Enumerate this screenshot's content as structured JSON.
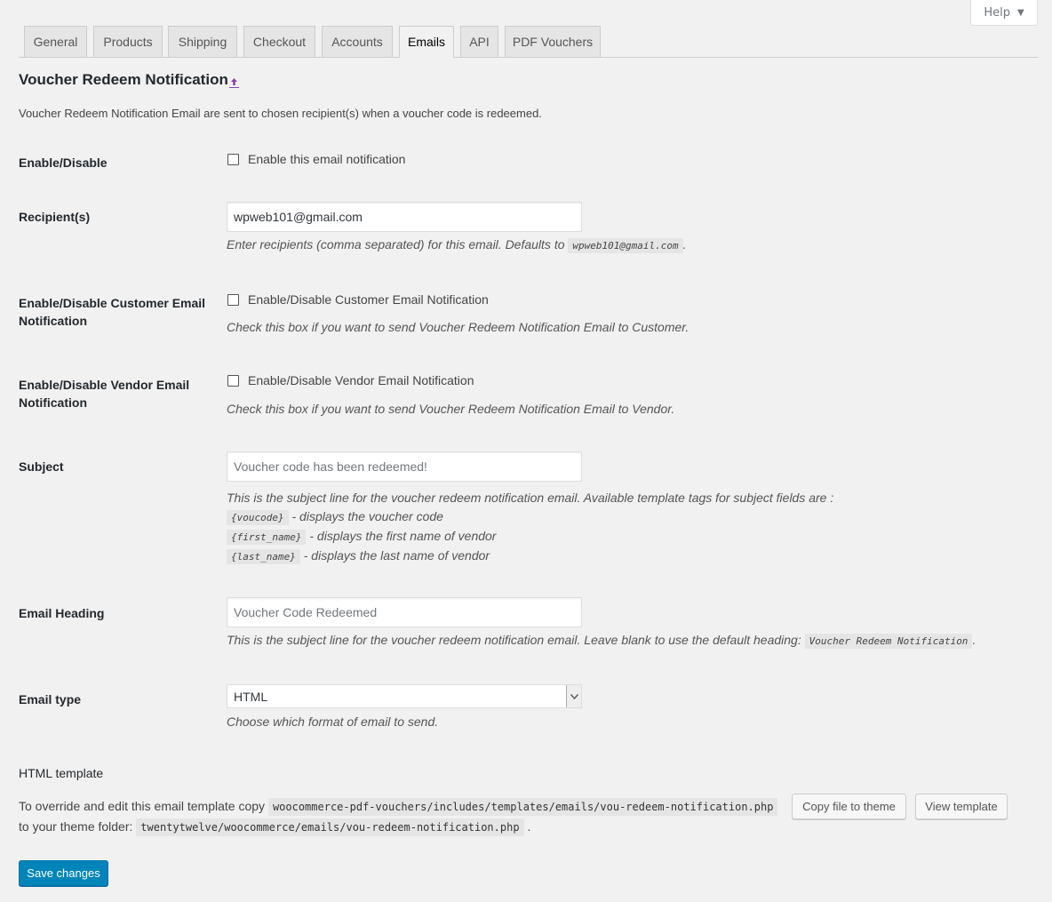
{
  "help": {
    "label": "Help"
  },
  "tabs": [
    {
      "label": "General",
      "active": false
    },
    {
      "label": "Products",
      "active": false
    },
    {
      "label": "Shipping",
      "active": false
    },
    {
      "label": "Checkout",
      "active": false
    },
    {
      "label": "Accounts",
      "active": false
    },
    {
      "label": "Emails",
      "active": true
    },
    {
      "label": "API",
      "active": false
    },
    {
      "label": "PDF Vouchers",
      "active": false
    }
  ],
  "heading": {
    "title": "Voucher Redeem Notification",
    "intro": "Voucher Redeem Notification Email are sent to chosen recipient(s) when a voucher code is redeemed."
  },
  "fields": {
    "enable": {
      "label": "Enable/Disable",
      "checkbox_label": "Enable this email notification",
      "checked": false
    },
    "recipients": {
      "label": "Recipient(s)",
      "value": "wpweb101@gmail.com",
      "desc": "Enter recipients (comma separated) for this email. Defaults to",
      "default_code": "wpweb101@gmail.com",
      "desc_end": "."
    },
    "customer": {
      "label": "Enable/Disable Customer Email Notification",
      "checkbox_label": "Enable/Disable Customer Email Notification",
      "desc": "Check this box if you want to send Voucher Redeem Notification Email to Customer.",
      "checked": false
    },
    "vendor": {
      "label": "Enable/Disable Vendor Email Notification",
      "checkbox_label": "Enable/Disable Vendor Email Notification",
      "desc": "Check this box if you want to send Voucher Redeem Notification Email to Vendor.",
      "checked": false
    },
    "subject": {
      "label": "Subject",
      "placeholder": "Voucher code has been redeemed!",
      "desc": "This is the subject line for the voucher redeem notification email. Available template tags for subject fields are :",
      "tags": [
        {
          "code": "{voucode}",
          "text": "- displays the voucher code"
        },
        {
          "code": "{first_name}",
          "text": "- displays the first name of vendor"
        },
        {
          "code": "{last_name}",
          "text": "- displays the last name of vendor"
        }
      ]
    },
    "heading": {
      "label": "Email Heading",
      "placeholder": "Voucher Code Redeemed",
      "desc": "This is the subject line for the voucher redeem notification email. Leave blank to use the default heading:",
      "default_code": "Voucher Redeem Notification",
      "desc_end": "."
    },
    "type": {
      "label": "Email type",
      "value": "HTML",
      "desc": "Choose which format of email to send."
    }
  },
  "template": {
    "title": "HTML template",
    "text1": "To override and edit this email template copy",
    "path1": "woocommerce-pdf-vouchers/includes/templates/emails/vou-redeem-notification.php",
    "text2": "to your theme folder:",
    "path2": "twentytwelve/woocommerce/emails/vou-redeem-notification.php",
    "text3": ".",
    "copy_button": "Copy file to theme",
    "view_button": "View template"
  },
  "save_button": "Save changes",
  "colors": {
    "primary": "#0085ba",
    "accent_arrow": "#8e44ad"
  }
}
